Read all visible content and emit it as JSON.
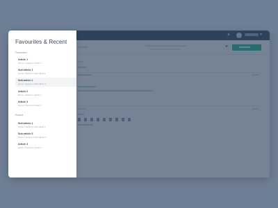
{
  "colors": {
    "page_bg": "#6f7f95",
    "topbar": "#2c4663",
    "accent": "#22b08f",
    "panel_bg": "#ffffff"
  },
  "panel": {
    "title": "Favourites & Recent",
    "sections": [
      {
        "label": "Favourites",
        "items": [
          {
            "title": "Article 1",
            "meta": "Name / Section / Article 1"
          },
          {
            "title": "Sub article 1",
            "meta": "Name / Section / Sub article 1"
          },
          {
            "title": "Sub article 2",
            "meta": "Name / Section / Sub article 2",
            "active": true
          },
          {
            "title": "Article 2",
            "meta": "Name / Section / Article 2"
          },
          {
            "title": "Article 3",
            "meta": "Name / Section / Article 3"
          }
        ]
      },
      {
        "label": "Recent",
        "items": [
          {
            "title": "Sub article 1",
            "meta": "Name / Section / Sub article 1"
          },
          {
            "title": "Sub article 3",
            "meta": "Name / Section / Sub article 3"
          },
          {
            "title": "Article 3",
            "meta": "Name / Section / Article 3"
          }
        ]
      }
    ]
  },
  "icons": {
    "notification": "bell-icon",
    "favourite": "heart-icon",
    "user_menu": "chevron-down-icon"
  }
}
